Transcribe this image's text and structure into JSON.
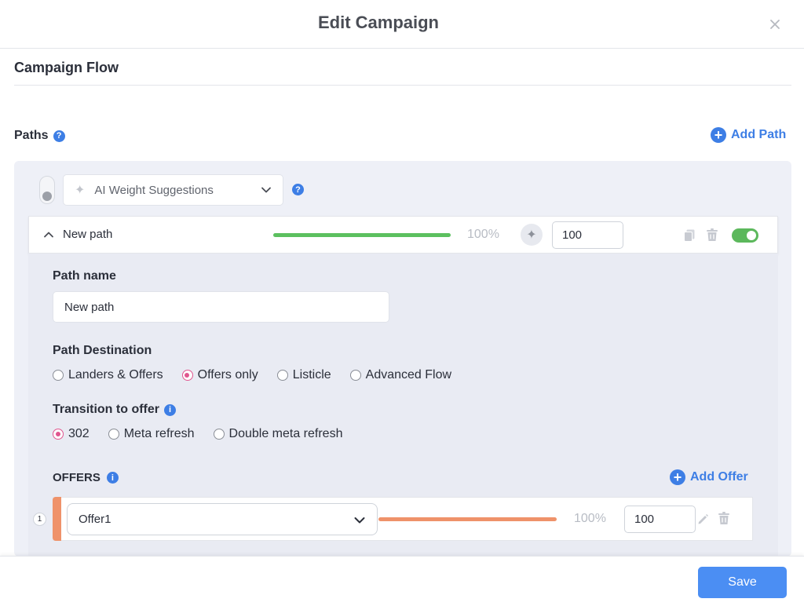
{
  "modal": {
    "title": "Edit Campaign"
  },
  "section": {
    "title": "Campaign Flow"
  },
  "paths": {
    "label": "Paths",
    "help_glyph": "?",
    "add_label": "Add Path",
    "add_glyph": "+"
  },
  "ai": {
    "label": "AI Weight Suggestions",
    "help_glyph": "?",
    "enabled": false
  },
  "path": {
    "title": "New path",
    "percent": "100%",
    "weight": "100",
    "share": 1.0,
    "active": true,
    "bar_color": "#5cc05f"
  },
  "path_form": {
    "name_label": "Path name",
    "name_value": "New path",
    "destination_label": "Path Destination",
    "destinations": [
      {
        "label": "Landers & Offers",
        "checked": false
      },
      {
        "label": "Offers only",
        "checked": true
      },
      {
        "label": "Listicle",
        "checked": false
      },
      {
        "label": "Advanced Flow",
        "checked": false
      }
    ],
    "transition_label": "Transition to offer",
    "transition_info_glyph": "i",
    "transitions": [
      {
        "label": "302",
        "checked": true
      },
      {
        "label": "Meta refresh",
        "checked": false
      },
      {
        "label": "Double meta refresh",
        "checked": false
      }
    ]
  },
  "offers": {
    "label": "OFFERS",
    "info_glyph": "i",
    "add_label": "Add Offer",
    "add_glyph": "+",
    "items": [
      {
        "index": "1",
        "name": "Offer1",
        "percent": "100%",
        "weight": "100",
        "share": 1.0,
        "color": "#ef926a"
      }
    ]
  },
  "footer": {
    "save_label": "Save"
  },
  "colors": {
    "accent": "#3d7ee5",
    "primary_button": "#4b8ef3",
    "radio_checked": "#e0568f",
    "toggle_on": "#5cb85c"
  }
}
